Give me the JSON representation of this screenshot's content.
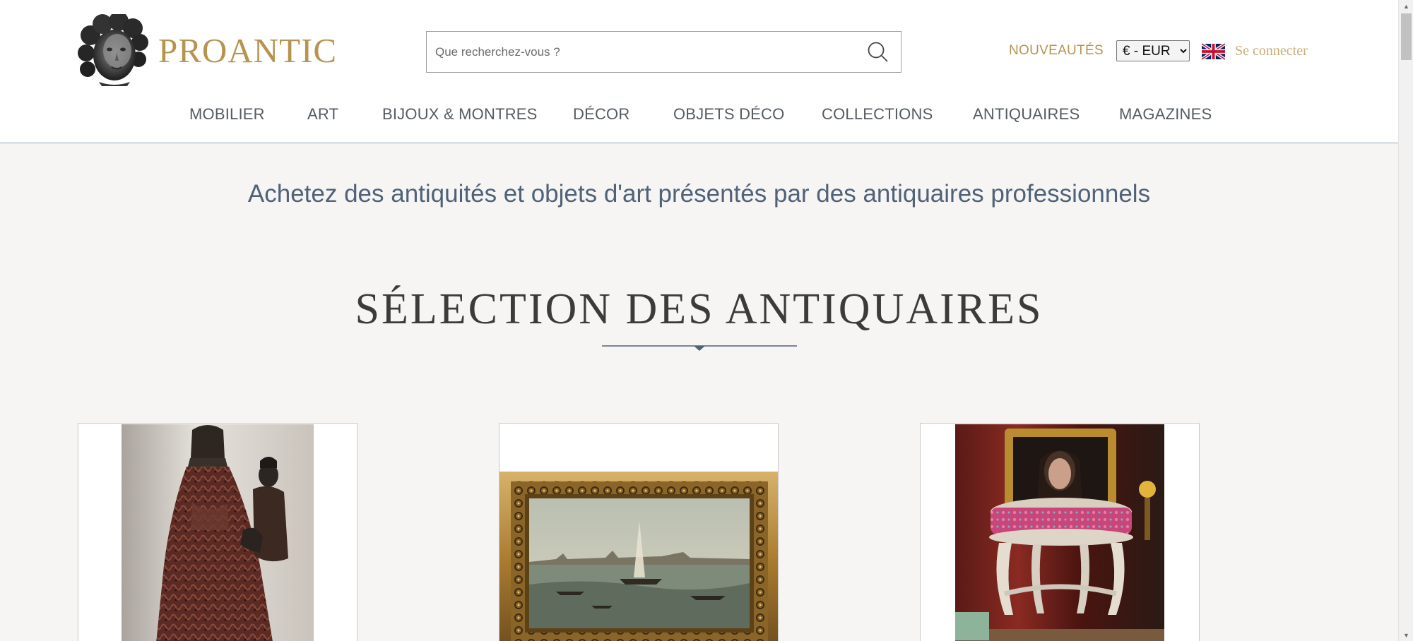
{
  "header": {
    "logo_text": "PROANTIC",
    "logo_icon": "putto-head-icon",
    "search": {
      "placeholder": "Que recherchez-vous ?",
      "value": "",
      "icon": "search-icon"
    },
    "new_link": "NOUVEAUTÉS",
    "currency": {
      "selected": "€ - EUR",
      "options": [
        "€ - EUR"
      ]
    },
    "language_flag": "uk-flag-icon",
    "login_link": "Se connecter"
  },
  "nav": {
    "items": [
      {
        "label": "MOBILIER"
      },
      {
        "label": "ART"
      },
      {
        "label": "BIJOUX & MONTRES"
      },
      {
        "label": "DÉCOR"
      },
      {
        "label": "OBJETS DÉCO"
      },
      {
        "label": "COLLECTIONS"
      },
      {
        "label": "ANTIQUAIRES"
      },
      {
        "label": "MAGAZINES"
      }
    ]
  },
  "main": {
    "tagline": "Achetez des antiquités et objets d'art présentés par des antiquaires professionnels",
    "section_title": "SÉLECTION DES ANTIQUAIRES",
    "cards": [
      {
        "image": "madonna-statue-image"
      },
      {
        "image": "venice-painting-image"
      },
      {
        "image": "stool-portrait-image"
      }
    ]
  },
  "colors": {
    "brand_gold": "#b79350",
    "login_gold": "#c9ad78",
    "tagline_blue": "#4f6278",
    "background": "#f7f5f3"
  }
}
